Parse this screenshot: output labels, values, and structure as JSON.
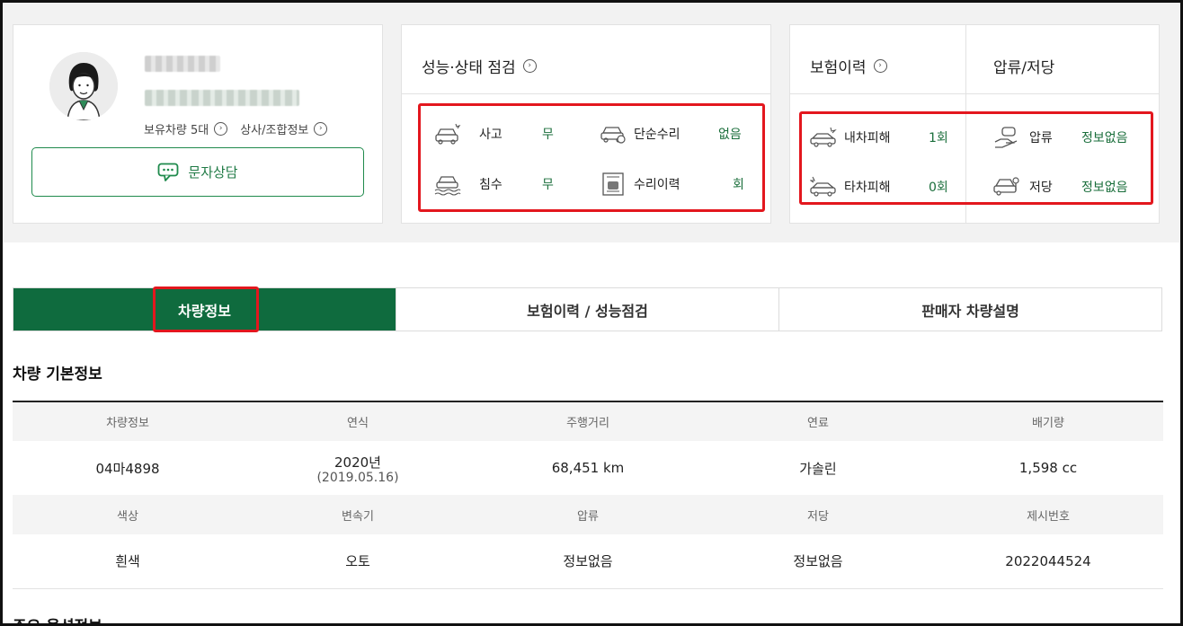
{
  "seller": {
    "vehicles_link": "보유차량 5대",
    "dealer_info_link": "상사/조합정보",
    "sms_button": "문자상담"
  },
  "inspection": {
    "title": "성능·상태 점검",
    "items": [
      {
        "label": "사고",
        "value": "무",
        "icon": "car-crash-icon"
      },
      {
        "label": "단순수리",
        "value": "없음",
        "icon": "car-repair-icon"
      },
      {
        "label": "침수",
        "value": "무",
        "icon": "car-flood-icon"
      },
      {
        "label": "수리이력",
        "value": "회",
        "icon": "document-car-icon"
      }
    ]
  },
  "insurance": {
    "title": "보험이력",
    "items": [
      {
        "label": "내차피해",
        "value": "1회",
        "icon": "my-car-damage-icon"
      },
      {
        "label": "타차피해",
        "value": "0회",
        "icon": "other-car-damage-icon"
      }
    ]
  },
  "seizure": {
    "title": "압류/저당",
    "items": [
      {
        "label": "압류",
        "value": "정보없음",
        "icon": "hand-car-icon"
      },
      {
        "label": "저당",
        "value": "정보없음",
        "icon": "car-key-icon"
      }
    ]
  },
  "tabs": [
    {
      "label": "차량정보",
      "active": true
    },
    {
      "label": "보험이력 / 성능점검",
      "active": false
    },
    {
      "label": "판매자 차량설명",
      "active": false
    }
  ],
  "basic_info": {
    "title": "차량 기본정보",
    "row1_headers": [
      "차량정보",
      "연식",
      "주행거리",
      "연료",
      "배기량"
    ],
    "row1_values": [
      "04마4898",
      "2020년",
      "68,451 km",
      "가솔린",
      "1,598 cc"
    ],
    "year_sub": "(2019.05.16)",
    "row2_headers": [
      "색상",
      "변속기",
      "압류",
      "저당",
      "제시번호"
    ],
    "row2_values": [
      "흰색",
      "오토",
      "정보없음",
      "정보없음",
      "2022044524"
    ]
  },
  "next_section_title": "주요 옵션정보",
  "colors": {
    "accent": "#0f6b3e",
    "highlight": "#e3171e"
  }
}
